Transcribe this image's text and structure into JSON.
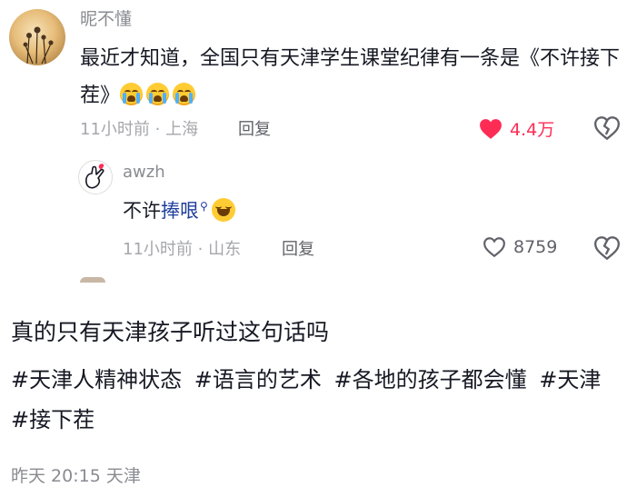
{
  "comment": {
    "username": "昵不懂",
    "text": "最近才知道，全国只有天津学生课堂纪律有一条是《不许接下茬》",
    "emojis": [
      "crying-emoji",
      "crying-emoji",
      "crying-emoji"
    ],
    "time_location": "11小时前 · 上海",
    "reply_label": "回复",
    "likes": "4.4万",
    "liked": true,
    "accent_color": "#fe2c55"
  },
  "reply": {
    "username": "awzh",
    "text_plain": "不许",
    "text_link": "捧哏",
    "emoji": "laughing-emoji",
    "time_location": "11小时前 · 山东",
    "reply_label": "回复",
    "likes": "8759"
  },
  "post": {
    "caption": "真的只有天津孩子听过这句话吗",
    "hashtags": [
      "#天津人精神状态",
      "#语言的艺术",
      "#各地的孩子都会懂",
      "#天津",
      "#接下茬"
    ],
    "footer": "昨天 20:15 天津"
  }
}
